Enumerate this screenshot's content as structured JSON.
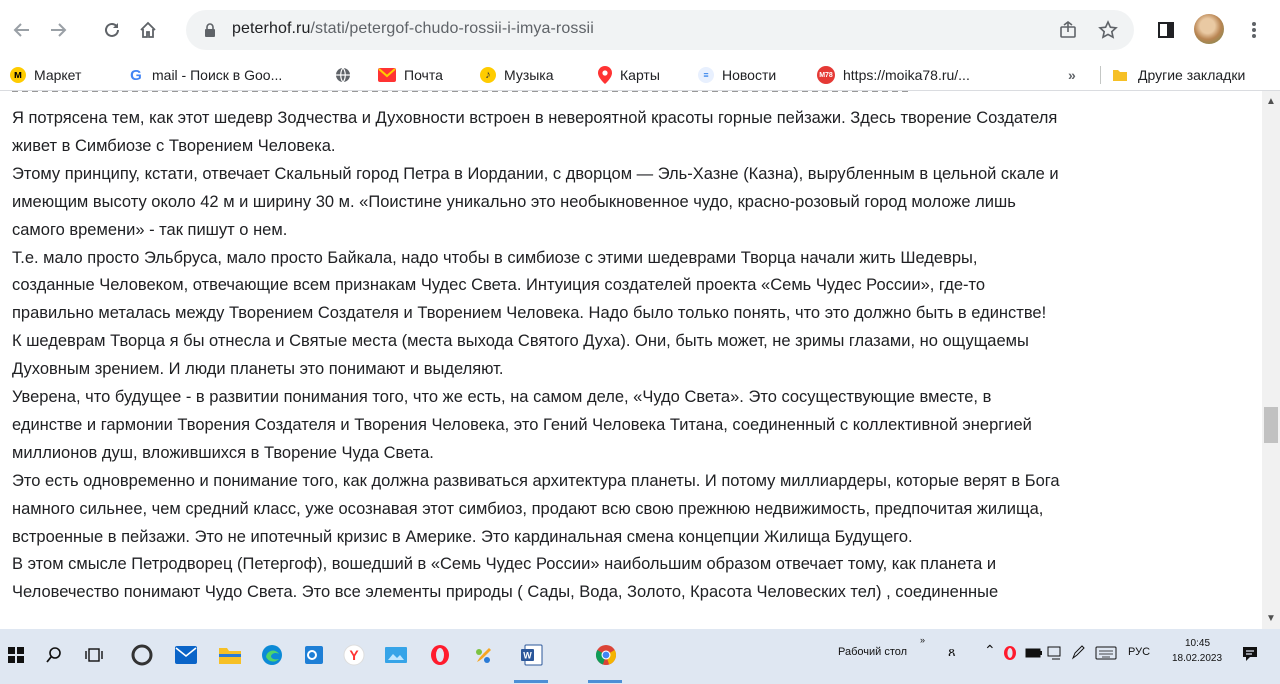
{
  "browser": {
    "url_domain": "peterhof.ru",
    "url_path": "/stati/petergof-chudo-rossii-i-imya-rossii"
  },
  "bookmarks": {
    "items": [
      {
        "label": "Маркет",
        "icon": "market-icon"
      },
      {
        "label": "mail - Поиск в Goo...",
        "icon": "google-icon"
      },
      {
        "label": "",
        "icon": "globe-icon"
      },
      {
        "label": "Почта",
        "icon": "mail-icon"
      },
      {
        "label": "Музыка",
        "icon": "music-icon"
      },
      {
        "label": "Карты",
        "icon": "maps-icon"
      },
      {
        "label": "Новости",
        "icon": "news-icon"
      },
      {
        "label": "https://moika78.ru/...",
        "icon": "m78-icon",
        "icon_text": "M78"
      }
    ],
    "more": "»",
    "other_folder": "Другие закладки"
  },
  "article": {
    "paragraphs": [
      [
        "Я потрясена тем, как этот шедевр Зодчества и Духовности встроен в невероятной красоты горные пейзажи. Здесь творение Создателя",
        "живет в Симбиозе с Творением Человека."
      ],
      [
        "Этому принципу, кстати, отвечает Скальный город Петра в Иордании, с дворцом — Эль-Хазне (Казна), вырубленным в цельной скале и",
        "имеющим высоту около 42 м и ширину 30 м. «Поистине уникально это необыкновенное чудо, красно-розовый город моложе лишь",
        "самого времени» - так пишут о нем."
      ],
      [
        "Т.е. мало просто Эльбруса, мало просто Байкала, надо чтобы в симбиозе с этими шедеврами Творца начали жить Шедевры,",
        "созданные Человеком, отвечающие всем признакам Чудес Света. Интуиция создателей проекта «Семь Чудес России», где-то",
        "правильно металась между Творением Создателя и Творением Человека. Надо было только понять, что это должно быть в единстве!"
      ],
      [
        "К шедеврам Творца я бы отнесла и Святые места (места выхода Святого Духа). Они, быть может, не зримы глазами, но ощущаемы",
        "Духовным зрением. И люди планеты это понимают и выделяют."
      ],
      [
        "Уверена, что будущее - в развитии понимания того, что же есть, на самом деле, «Чудо Света». Это сосуществующие вместе, в",
        "единстве и гармонии Творения Создателя и Творения Человека, это Гений Человека Титана, соединенный с коллективной энергией",
        "миллионов душ, вложившихся в Творение Чуда Света."
      ],
      [
        "Это есть одновременно и понимание того, как должна развиваться архитектура планеты. И потому миллиардеры, которые верят в Бога",
        "намного сильнее, чем средний класс, уже осознавая этот симбиоз, продают всю свою прежнюю недвижимость, предпочитая жилища,",
        "встроенные в пейзажи. Это не ипотечный кризис в Америке. Это кардинальная смена концепции Жилища Будущего."
      ],
      [
        "В этом смысле Петродворец (Петергоф), вошедший в «Семь Чудес России» наибольшим образом отвечает тому, как планета и",
        "Человечество понимают Чудо Света. Это все элементы природы ( Сады, Вода, Золото, Красота Человеских тел) , соединенные"
      ]
    ]
  },
  "taskbar": {
    "desktop_label": "Рабочий стол",
    "chevron": "»",
    "lang": "РУС",
    "time": "10:45",
    "date": "18.02.2023"
  },
  "colors": {
    "accent": "#1a73e8",
    "taskbar": "#dfe7f2"
  }
}
